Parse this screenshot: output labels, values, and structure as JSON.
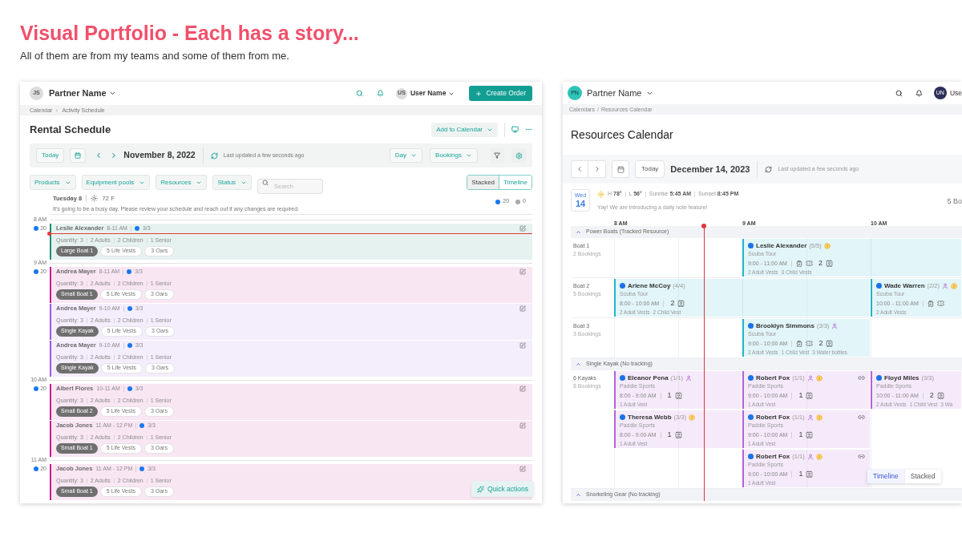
{
  "page": {
    "title": "Visual Portfolio - Each has a story...",
    "subtitle": "All of them are from my teams and some of them from me."
  },
  "rental_schedule": {
    "topbar": {
      "avatar": "JS",
      "partner": "Partner Name",
      "user_avatar": "US",
      "user": "User Name",
      "action": "Create Order"
    },
    "breadcrumb": [
      "Calendar",
      "Activity Schedule"
    ],
    "title": "Rental Schedule",
    "add_button": "Add to Calendar",
    "toolbar": {
      "today": "Today",
      "date": "November 8, 2022",
      "updated": "Last updated a few seconds ago",
      "view": "Day",
      "mode": "Bookings"
    },
    "filters": [
      "Products",
      "Equipment pools",
      "Resources",
      "Status"
    ],
    "search": {
      "placeholder": "Search"
    },
    "view_toggle": [
      {
        "label": "Stacked",
        "selected": true
      },
      {
        "label": "Timeline",
        "selected": false
      }
    ],
    "day": {
      "label": "Tuesday 8",
      "temperature": "72 F",
      "note": "It's going to be a busy day. Please review your schedule and reach out if any changes are required.",
      "counts": [
        {
          "value": "20",
          "color": "#1877f2"
        },
        {
          "value": "0",
          "color": "#a8a8a8"
        }
      ]
    },
    "hours": [
      {
        "label": "8 AM",
        "count": "20",
        "now": true,
        "bookings": [
          {
            "name": "Leslie Alexander",
            "time": "8-11 AM",
            "capacity": "3/3",
            "details": [
              "Quantity: 3",
              "2 Adults",
              "2 Children",
              "1 Senior"
            ],
            "resource": "Large Boat 1",
            "items": [
              "5 Life Vests",
              "3 Oars"
            ],
            "color": "#1e8c74"
          }
        ]
      },
      {
        "label": "9 AM",
        "count": "20",
        "now": false,
        "bookings": [
          {
            "name": "Andrea Mayer",
            "time": "8-11 AM",
            "capacity": "3/3",
            "details": [
              "Quantity: 3",
              "2 Adults",
              "2 Children",
              "1 Senior"
            ],
            "resource": "Small Boat 1",
            "items": [
              "5 Life Vests",
              "3 Oars"
            ],
            "color": "#c4198f"
          },
          {
            "name": "Andrea Mayer",
            "time": "9-10 AM",
            "capacity": "3/3",
            "details": [
              "Quantity: 3",
              "2 Adults",
              "2 Children",
              "1 Senior"
            ],
            "resource": "Single Kayak",
            "items": [
              "5 Life Vests",
              "3 Oars"
            ],
            "color": "#9b59e0"
          },
          {
            "name": "Andrea Mayer",
            "time": "9-10 AM",
            "capacity": "3/3",
            "details": [
              "Quantity: 3",
              "2 Adults",
              "2 Children",
              "1 Senior"
            ],
            "resource": "Single Kayak",
            "items": [
              "5 Life Vests",
              "3 Oars"
            ],
            "color": "#9b59e0"
          }
        ]
      },
      {
        "label": "10 AM",
        "count": "20",
        "now": false,
        "bookings": [
          {
            "name": "Albert Flores",
            "time": "10-11 AM",
            "capacity": "3/3",
            "details": [
              "Quantity: 3",
              "2 Adults",
              "2 Children",
              "1 Senior"
            ],
            "resource": "Small Boat 2",
            "items": [
              "5 Life Vests",
              "3 Oars"
            ],
            "color": "#c4198f"
          },
          {
            "name": "Jacob Jones",
            "time": "11 AM - 12 PM",
            "capacity": "3/3",
            "details": [
              "Quantity: 3",
              "2 Adults",
              "2 Children",
              "1 Senior"
            ],
            "resource": "Small Boat 1",
            "items": [
              "5 Life Vests",
              "3 Oars"
            ],
            "color": "#c4198f"
          }
        ]
      },
      {
        "label": "11 AM",
        "count": "20",
        "now": false,
        "bookings": [
          {
            "name": "Jacob Jones",
            "time": "11 AM - 12 PM",
            "capacity": "3/3",
            "details": [
              "Quantity: 3",
              "2 Adults",
              "2 Children",
              "1 Senior"
            ],
            "resource": "Small Boat 1",
            "items": [
              "5 Life Vests",
              "3 Oars"
            ],
            "color": "#c4198f"
          }
        ]
      }
    ],
    "quick_actions": "Quick actions"
  },
  "resources_calendar": {
    "topbar": {
      "avatar": "PN",
      "partner": "Partner Name",
      "user_avatar": "UN",
      "user": "Use"
    },
    "breadcrumb": {
      "items": [
        "Calendars",
        "Resources Calendar"
      ],
      "separator": "/"
    },
    "title": "Resources Calendar",
    "toolbar": {
      "today": "Today",
      "date": "December 14, 2023",
      "updated": "Last updated a few seconds ago"
    },
    "day": {
      "weekday": "Wed",
      "date": "14",
      "weather": [
        "H **78°**",
        "L **56°**",
        "Sunrise **5:45 AM**",
        "Sunset **8:45 PM**"
      ],
      "note": "Yay! We are introducing a daily note feature!",
      "summary": "5 Bo"
    },
    "hours": [
      "8 AM",
      "9 AM",
      "10 AM"
    ],
    "groups": [
      {
        "name": "Power Boats (Tracked Resource)",
        "expanded": true,
        "resources": [
          {
            "name": "Boat 1",
            "count": "2 Bookings",
            "lanes": [
              [
                {
                  "kind": "empty"
                },
                {
                  "kind": "long",
                  "name": "Leslie Alexander",
                  "capacity": "(5/5)",
                  "guest": false,
                  "paid": true,
                  "linked": false,
                  "activity": "Scuba Tour",
                  "time": "9:00 - 11:00 AM",
                  "forms": true,
                  "quantity": "2",
                  "extras": [
                    "2 Adult Vests",
                    "3 Child Vests"
                  ],
                  "color": "#22b4c8"
                }
              ]
            ]
          },
          {
            "name": "Boat 2",
            "count": "5 Bookings",
            "lanes": [
              [
                {
                  "kind": "long",
                  "name": "Arlene McCoy",
                  "capacity": "(4/4)",
                  "guest": false,
                  "paid": false,
                  "linked": false,
                  "activity": "Scuba Tour",
                  "time": "8:00 - 10:00 AM",
                  "forms": false,
                  "quantity": "2",
                  "extras": [
                    "2 Adult Vests",
                    "2 Child Vest"
                  ],
                  "color": "#22b4c8"
                },
                {
                  "kind": "short",
                  "name": "Wade Warren",
                  "capacity": "(2/2)",
                  "guest": true,
                  "paid": true,
                  "linked": false,
                  "activity": "Scuba Tour",
                  "time": "10:00 - 11:00 AM",
                  "forms": true,
                  "extras": [
                    "2 Adult Vests"
                  ],
                  "color": "#22b4c8"
                }
              ]
            ]
          },
          {
            "name": "Boat 3",
            "count": "3 Bookings",
            "lanes": [
              [
                {
                  "kind": "empty"
                },
                {
                  "kind": "short",
                  "name": "Brooklyn Simmons",
                  "capacity": "(3/3)",
                  "guest": true,
                  "paid": false,
                  "linked": false,
                  "activity": "Scuba Tour",
                  "time": "9:00 - 10:00 AM",
                  "forms": true,
                  "quantity": "2",
                  "extras": [
                    "2 Adult Vests",
                    "1 Child Vest",
                    "3 Water bottles"
                  ],
                  "color": "#22b4c8"
                }
              ]
            ]
          }
        ]
      },
      {
        "name": "Single Kayak (No tracking)",
        "expanded": true,
        "resources": [
          {
            "name": "6 Kayaks",
            "count": "8 Bookings",
            "lanes": [
              [
                {
                  "kind": "short",
                  "name": "Eleanor Pena",
                  "capacity": "(1/1)",
                  "guest": true,
                  "paid": false,
                  "linked": false,
                  "activity": "Paddle Sports",
                  "time": "8:00 - 9:00 AM",
                  "forms": false,
                  "quantity": "1",
                  "extras": [
                    "1 Adult Vest"
                  ],
                  "color": "#b462d8"
                },
                {
                  "kind": "short",
                  "name": "Robert Fox",
                  "capacity": "(1/1)",
                  "guest": true,
                  "paid": true,
                  "linked": true,
                  "activity": "Paddle Sports",
                  "time": "9:00 - 10:00 AM",
                  "forms": false,
                  "quantity": "1",
                  "extras": [
                    "1 Adult Vest"
                  ],
                  "color": "#b462d8"
                },
                {
                  "kind": "short",
                  "name": "Floyd Miles",
                  "capacity": "(3/3)",
                  "guest": false,
                  "paid": false,
                  "linked": false,
                  "activity": "Paddle Sports",
                  "time": "10:00 - 11:00 AM",
                  "forms": false,
                  "quantity": "2",
                  "extras": [
                    "2 Adult Vests",
                    "1 Child Vest",
                    "3 Wa"
                  ],
                  "color": "#b462d8"
                }
              ],
              [
                {
                  "kind": "short",
                  "name": "Theresa Webb",
                  "capacity": "(3/3)",
                  "guest": false,
                  "paid": true,
                  "linked": false,
                  "activity": "Paddle Sports",
                  "time": "8:00 - 9:00 AM",
                  "forms": false,
                  "quantity": "1",
                  "extras": [
                    "1 Adult Vest"
                  ],
                  "color": "#b462d8"
                },
                {
                  "kind": "short",
                  "name": "Robert Fox",
                  "capacity": "(1/1)",
                  "guest": true,
                  "paid": true,
                  "linked": true,
                  "activity": "Paddle Sports",
                  "time": "9:00 - 10:00 AM",
                  "forms": false,
                  "quantity": "1",
                  "extras": [
                    "1 Adult Vest"
                  ],
                  "color": "#b462d8"
                }
              ],
              [
                {
                  "kind": "empty"
                },
                {
                  "kind": "short",
                  "name": "Robert Fox",
                  "capacity": "(1/1)",
                  "guest": true,
                  "paid": true,
                  "linked": true,
                  "activity": "Paddle Sports",
                  "time": "9:00 - 10:00 AM",
                  "forms": false,
                  "quantity": "1",
                  "extras": [
                    "1 Adult Vest"
                  ],
                  "color": "#b462d8"
                }
              ]
            ]
          }
        ]
      },
      {
        "name": "Snorkeling Gear (No tracking)",
        "expanded": true
      }
    ],
    "view_toggle": [
      {
        "label": "Timeline",
        "selected": true
      },
      {
        "label": "Stacked",
        "selected": false
      }
    ]
  }
}
